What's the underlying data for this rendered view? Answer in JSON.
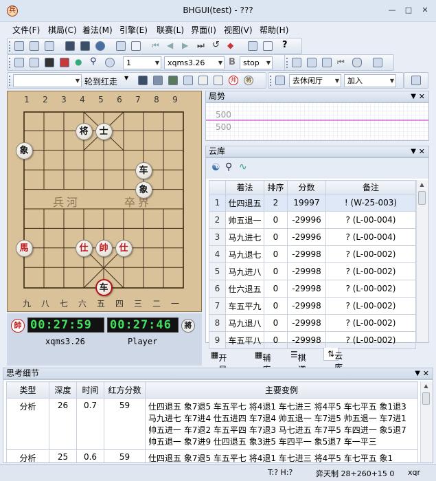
{
  "window": {
    "title": "BHGUI(test) - ???",
    "icon_char": "兵"
  },
  "menu": [
    "文件(F)",
    "棋局(C)",
    "着法(M)",
    "引擎(E)",
    "联赛(L)",
    "界面(I)",
    "视图(V)",
    "帮助(H)"
  ],
  "toolbar2": {
    "move_number": "1",
    "engine": "xqms3.26",
    "engine_btn": "B",
    "stop_label": "stop"
  },
  "toolbar3": {
    "opening_label": "轮到红走",
    "hall_label": "去休闲厅",
    "join_label": "加入"
  },
  "board": {
    "top_files": [
      "1",
      "2",
      "3",
      "4",
      "5",
      "6",
      "7",
      "8",
      "9"
    ],
    "bottom_files": [
      "九",
      "八",
      "七",
      "六",
      "五",
      "四",
      "三",
      "二",
      "一"
    ],
    "river_left": "兵河",
    "river_right": "卒界",
    "pieces": [
      {
        "char": "将",
        "color": "black",
        "file": 3,
        "rank": 1
      },
      {
        "char": "士",
        "color": "black",
        "file": 4,
        "rank": 1
      },
      {
        "char": "象",
        "color": "black",
        "file": 0,
        "rank": 2
      },
      {
        "char": "车",
        "color": "black",
        "file": 6,
        "rank": 3
      },
      {
        "char": "象",
        "color": "black",
        "file": 6,
        "rank": 4
      },
      {
        "char": "馬",
        "color": "red",
        "file": 0,
        "rank": 7
      },
      {
        "char": "仕",
        "color": "red",
        "file": 3,
        "rank": 7
      },
      {
        "char": "帥",
        "color": "red",
        "file": 4,
        "rank": 7
      },
      {
        "char": "仕",
        "color": "red",
        "file": 5,
        "rank": 7
      },
      {
        "char": "车",
        "color": "black",
        "file": 4,
        "rank": 9,
        "selected": true
      }
    ]
  },
  "clocks": {
    "red_side": "帥",
    "red_time": "00:27:59",
    "black_time": "00:27:46",
    "black_side": "將",
    "red_player": "xqms3.26",
    "black_player": "Player"
  },
  "situation_panel": {
    "title": "局势",
    "tick_upper": "500",
    "tick_lower": "500"
  },
  "cloud_panel": {
    "title": "云库",
    "columns": [
      "着法",
      "排序",
      "分数",
      "备注"
    ],
    "rows": [
      {
        "n": "1",
        "move": "仕四退五",
        "rank": "2",
        "score": "19997",
        "note": "! (W-25-003)"
      },
      {
        "n": "2",
        "move": "帅五退一",
        "rank": "0",
        "score": "-29996",
        "note": "? (L-00-004)"
      },
      {
        "n": "3",
        "move": "马九进七",
        "rank": "0",
        "score": "-29996",
        "note": "? (L-00-004)"
      },
      {
        "n": "4",
        "move": "马九退七",
        "rank": "0",
        "score": "-29998",
        "note": "? (L-00-002)"
      },
      {
        "n": "5",
        "move": "马九进八",
        "rank": "0",
        "score": "-29998",
        "note": "? (L-00-002)"
      },
      {
        "n": "6",
        "move": "仕六退五",
        "rank": "0",
        "score": "-29998",
        "note": "? (L-00-002)"
      },
      {
        "n": "7",
        "move": "车五平九",
        "rank": "0",
        "score": "-29998",
        "note": "? (L-00-002)"
      },
      {
        "n": "8",
        "move": "马九退八",
        "rank": "0",
        "score": "-29998",
        "note": "? (L-00-002)"
      },
      {
        "n": "9",
        "move": "车五平八",
        "rank": "0",
        "score": "-29998",
        "note": "? (L-00-002)"
      }
    ]
  },
  "tabs": [
    "开局库",
    "辅库",
    "棋谱",
    "云库"
  ],
  "think_panel": {
    "title": "思考细节",
    "columns": [
      "类型",
      "深度",
      "时间",
      "红方分数",
      "主要变例"
    ],
    "rows": [
      {
        "type": "分析",
        "depth": "26",
        "time": "0.7",
        "score": "59",
        "pv": "仕四退五 象7退5 车五平七 将4退1 车七进三 将4平5 车七平五 象1退3 马九进七 车7进4 仕五进四 车7退4 帅五退一 车7进5 帅五退一 车7进1 帅五进一 车7退2 车五平四 车7退3 马七进五 车7平5 车四进一 象5退7 帅五退一 象7进9 仕四退五 象3进5 车四平一 象5退7 车一平三"
      },
      {
        "type": "分析",
        "depth": "25",
        "time": "0.6",
        "score": "59",
        "pv": "仕四退五 象7退5 车五平七 将4退1 车七进三 将4平5 车七平五 象1"
      }
    ]
  },
  "status": {
    "hint": "T:? H:?",
    "rule": "弈天制 28+260+15 0",
    "user": "xqr"
  }
}
